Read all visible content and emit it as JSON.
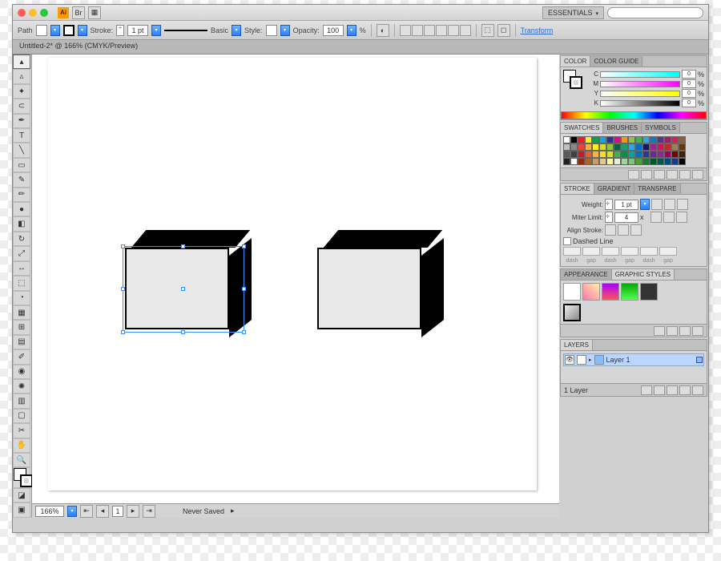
{
  "titlebar": {
    "workspace": "ESSENTIALS",
    "search_placeholder": ""
  },
  "control_bar": {
    "selection_type": "Path",
    "stroke_label": "Stroke:",
    "stroke_weight": "1 pt",
    "brush": "Basic",
    "style_label": "Style:",
    "opacity_label": "Opacity:",
    "opacity_value": "100",
    "opacity_unit": "%",
    "transform_link": "Transform"
  },
  "document_tab": "Untitled-2* @ 166% (CMYK/Preview)",
  "status_bar": {
    "zoom": "166%",
    "status": "Never Saved"
  },
  "panels": {
    "color": {
      "tabs": [
        "COLOR",
        "COLOR GUIDE"
      ],
      "channels": [
        {
          "label": "C",
          "value": "0",
          "unit": "%"
        },
        {
          "label": "M",
          "value": "0",
          "unit": "%"
        },
        {
          "label": "Y",
          "value": "0",
          "unit": "%"
        },
        {
          "label": "K",
          "value": "0",
          "unit": "%"
        }
      ]
    },
    "swatches": {
      "tabs": [
        "SWATCHES",
        "BRUSHES",
        "SYMBOLS"
      ]
    },
    "stroke": {
      "tabs": [
        "STROKE",
        "GRADIENT",
        "TRANSPARE"
      ],
      "weight_label": "Weight:",
      "weight_value": "1 pt",
      "miter_label": "Miter Limit:",
      "miter_value": "4",
      "miter_unit": "x",
      "align_label": "Align Stroke:",
      "dashed_label": "Dashed Line",
      "dash_headers": [
        "dash",
        "gap",
        "dash",
        "gap",
        "dash",
        "gap"
      ]
    },
    "appearance": {
      "tabs": [
        "APPEARANCE",
        "GRAPHIC STYLES"
      ]
    },
    "layers": {
      "tabs": [
        "LAYERS"
      ],
      "layer_name": "Layer 1",
      "footer": "1 Layer"
    }
  },
  "swatch_colors": [
    "#fff",
    "#000",
    "#ed1c24",
    "#fff200",
    "#00a651",
    "#00aeef",
    "#2e3192",
    "#ec008c",
    "#f7941d",
    "#8dc63e",
    "#39b54a",
    "#27aae1",
    "#1b75bc",
    "#662d91",
    "#9e1f63",
    "#da1c5c",
    "#8b5e3c",
    "#c0c0c0",
    "#898989",
    "#ef4136",
    "#faaf3b",
    "#fcee21",
    "#d7df23",
    "#8cc63f",
    "#006838",
    "#1b9e77",
    "#29abe2",
    "#0071bc",
    "#1b1464",
    "#93278f",
    "#d4145a",
    "#c1272d",
    "#a67c52",
    "#603913",
    "#58595b",
    "#414042",
    "#be1e2d",
    "#f15a29",
    "#fbb040",
    "#ffde17",
    "#d9e021",
    "#39b54a",
    "#009444",
    "#00a99d",
    "#0072bc",
    "#2b3990",
    "#652d90",
    "#92278f",
    "#9e005d",
    "#790000",
    "#42210b",
    "#231f20",
    "#ffffff",
    "#942911",
    "#b0641e",
    "#c69c6d",
    "#e6c88e",
    "#fff9ae",
    "#e2f0d9",
    "#a2d39c",
    "#7cc576",
    "#4f9e37",
    "#197b30",
    "#005826",
    "#005952",
    "#004a80",
    "#1b378b",
    "#000"
  ]
}
